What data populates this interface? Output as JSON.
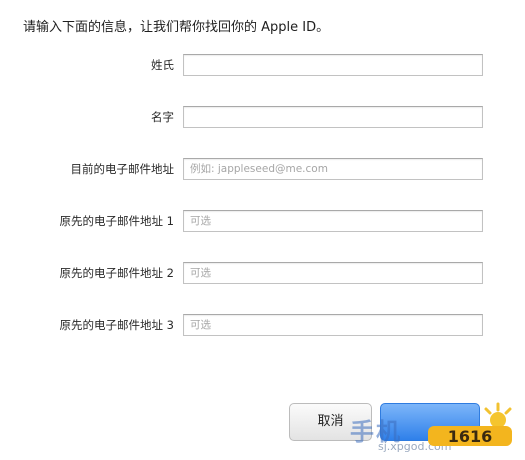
{
  "intro_text": "请输入下面的信息，让我们帮你找回你的 Apple ID。",
  "form": {
    "fields": [
      {
        "label": "姓氏",
        "value": "",
        "placeholder": ""
      },
      {
        "label": "名字",
        "value": "",
        "placeholder": ""
      },
      {
        "label": "目前的电子邮件地址",
        "value": "",
        "placeholder": "例如: jappleseed@me.com"
      },
      {
        "label": "原先的电子邮件地址 1",
        "value": "",
        "placeholder": "可选"
      },
      {
        "label": "原先的电子邮件地址 2",
        "value": "",
        "placeholder": "可选"
      },
      {
        "label": "原先的电子邮件地址 3",
        "value": "",
        "placeholder": "可选"
      }
    ]
  },
  "buttons": {
    "cancel_label": "取消",
    "continue_label": ""
  },
  "watermark": {
    "text_cn": "手机",
    "text_url": "sj.xpgod.com",
    "logo_text": "1616"
  },
  "colors": {
    "primary_button": "#2f80ea",
    "field_border": "#c2c2c2",
    "placeholder": "#a6a6a6"
  }
}
